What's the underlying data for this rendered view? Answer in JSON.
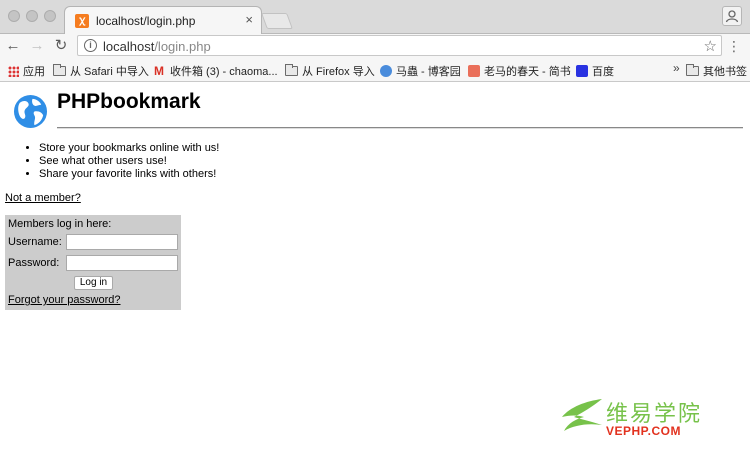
{
  "browser": {
    "tab_title": "localhost/login.php",
    "close_glyph": "×",
    "url_host": "localhost",
    "url_path": "/login.php",
    "bookmarks": [
      {
        "label": "应用",
        "icon": "apps-grid-icon"
      },
      {
        "label": "从 Safari 中导入",
        "icon": "folder-icon"
      },
      {
        "label": "收件箱 (3) - chaoma...",
        "icon": "gmail-icon"
      },
      {
        "label": "从 Firefox 导入",
        "icon": "folder-icon"
      },
      {
        "label": "马蟲 - 博客园",
        "icon": "blog-icon"
      },
      {
        "label": "老马的春天 - 简书",
        "icon": "jianshu-icon"
      },
      {
        "label": "百度",
        "icon": "baidu-icon"
      }
    ],
    "overflow_glyph": "»",
    "other_bookmarks": "其他书签"
  },
  "page": {
    "title": "PHPbookmark",
    "features": [
      "Store your bookmarks online with us!",
      "See what other users use!",
      "Share your favorite links with others!"
    ],
    "not_member_link": "Not a member?",
    "login": {
      "heading": "Members log in here:",
      "username_label": "Username:",
      "username_value": "",
      "password_label": "Password:",
      "password_value": "",
      "submit_label": "Log in",
      "forgot_link": "Forgot your password?"
    }
  },
  "watermark": {
    "text": "维易学院",
    "url": "VEPHP.COM"
  },
  "colors": {
    "login_box_bg": "#cccccc",
    "watermark_green": "#77c24a",
    "watermark_red": "#e2321f",
    "tab_favicon": "#f57c1f"
  }
}
